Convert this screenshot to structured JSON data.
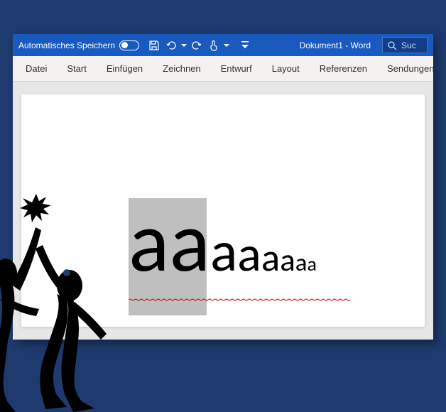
{
  "titlebar": {
    "autosave_label": "Automatisches Speichern",
    "doc_title": "Dokument1  -  Word",
    "search_placeholder": "Suc"
  },
  "ribbon": {
    "tabs": [
      "Datei",
      "Start",
      "Einfügen",
      "Zeichnen",
      "Entwurf",
      "Layout",
      "Referenzen",
      "Sendungen"
    ]
  },
  "document": {
    "letters": [
      {
        "char": "a",
        "size": 120
      },
      {
        "char": "a",
        "size": 120
      },
      {
        "char": "a",
        "size": 80
      },
      {
        "char": "a",
        "size": 70
      },
      {
        "char": "a",
        "size": 55
      },
      {
        "char": "a",
        "size": 45
      },
      {
        "char": "a",
        "size": 35
      },
      {
        "char": "a",
        "size": 28
      }
    ]
  }
}
